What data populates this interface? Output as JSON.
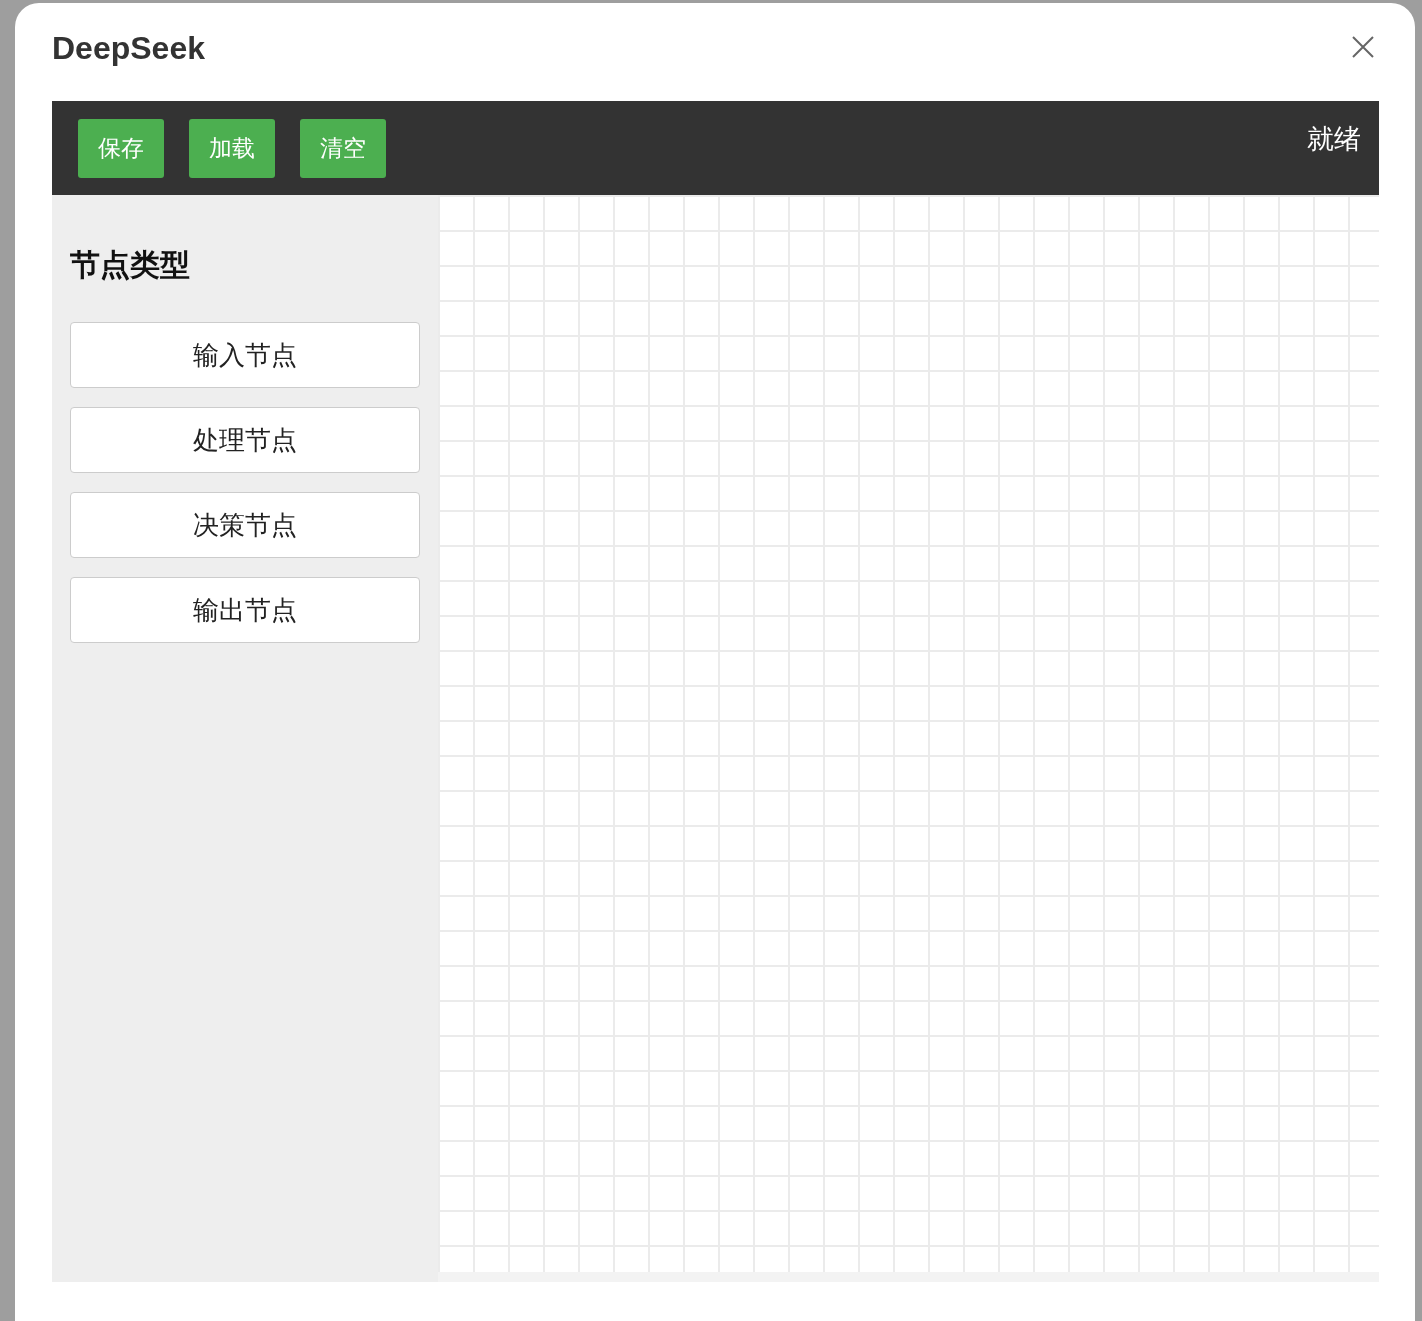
{
  "window": {
    "title": "DeepSeek"
  },
  "toolbar": {
    "buttons": [
      "保存",
      "加载",
      "清空"
    ],
    "status": "就绪"
  },
  "sidebar": {
    "heading": "节点类型",
    "items": [
      "输入节点",
      "处理节点",
      "决策节点",
      "输出节点"
    ]
  }
}
